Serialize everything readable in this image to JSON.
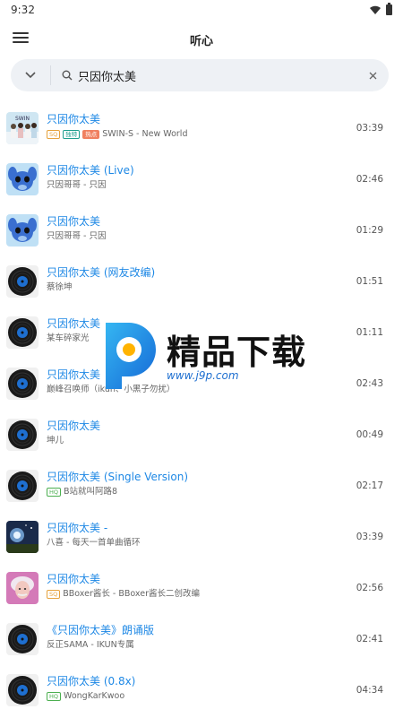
{
  "status_bar": {
    "time": "9:32"
  },
  "app_bar": {
    "title": "听心"
  },
  "search": {
    "query": "只因你太美",
    "placeholder": ""
  },
  "songs": [
    {
      "title": "只因你太美",
      "badges": [
        "SQ",
        "独特",
        "热点"
      ],
      "subtitle": "SWIN-S - New World",
      "duration": "03:39",
      "cover": "group"
    },
    {
      "title": "只因你太美 (Live)",
      "badges": [],
      "subtitle": "只因哥哥 - 只因",
      "duration": "02:46",
      "cover": "stitch"
    },
    {
      "title": "只因你太美",
      "badges": [],
      "subtitle": "只因哥哥 - 只因",
      "duration": "01:29",
      "cover": "stitch"
    },
    {
      "title": "只因你太美 (网友改编)",
      "badges": [],
      "subtitle": "蔡徐坤",
      "duration": "01:51",
      "cover": "vinyl"
    },
    {
      "title": "只因你太美",
      "badges": [],
      "subtitle": "某车碎家光",
      "duration": "01:11",
      "cover": "vinyl"
    },
    {
      "title": "只因你太美",
      "badges": [],
      "subtitle": "巅峰召唤师（ikun、小黑子勿扰）",
      "duration": "02:43",
      "cover": "vinyl"
    },
    {
      "title": "只因你太美",
      "badges": [],
      "subtitle": "坤儿",
      "duration": "00:49",
      "cover": "vinyl"
    },
    {
      "title": "只因你太美 (Single Version)",
      "badges": [
        "HQ"
      ],
      "subtitle": "B站就叫阿路8",
      "duration": "02:17",
      "cover": "vinyl"
    },
    {
      "title": "只因你太美 -",
      "badges": [],
      "subtitle": "八喜 - 每天一首单曲循环",
      "duration": "03:39",
      "cover": "night"
    },
    {
      "title": "只因你太美",
      "badges": [
        "SQ"
      ],
      "subtitle": "BBoxer酱长 - BBoxer酱长二创改编",
      "duration": "02:56",
      "cover": "einstein"
    },
    {
      "title": "《只因你太美》朗诵版",
      "badges": [],
      "subtitle": "反正SAMA - IKUN专属",
      "duration": "02:41",
      "cover": "vinyl"
    },
    {
      "title": "只因你太美 (0.8x)",
      "badges": [
        "HQ"
      ],
      "subtitle": "WongKarKwoo",
      "duration": "04:34",
      "cover": "vinyl"
    }
  ],
  "watermark": {
    "brand": "精品下载",
    "url": "www.j9p.com"
  },
  "colors": {
    "accent": "#1e88e5",
    "search_bg": "#eef1f5",
    "sq_badge": "#e6a23c",
    "hq_badge": "#4caf50"
  }
}
